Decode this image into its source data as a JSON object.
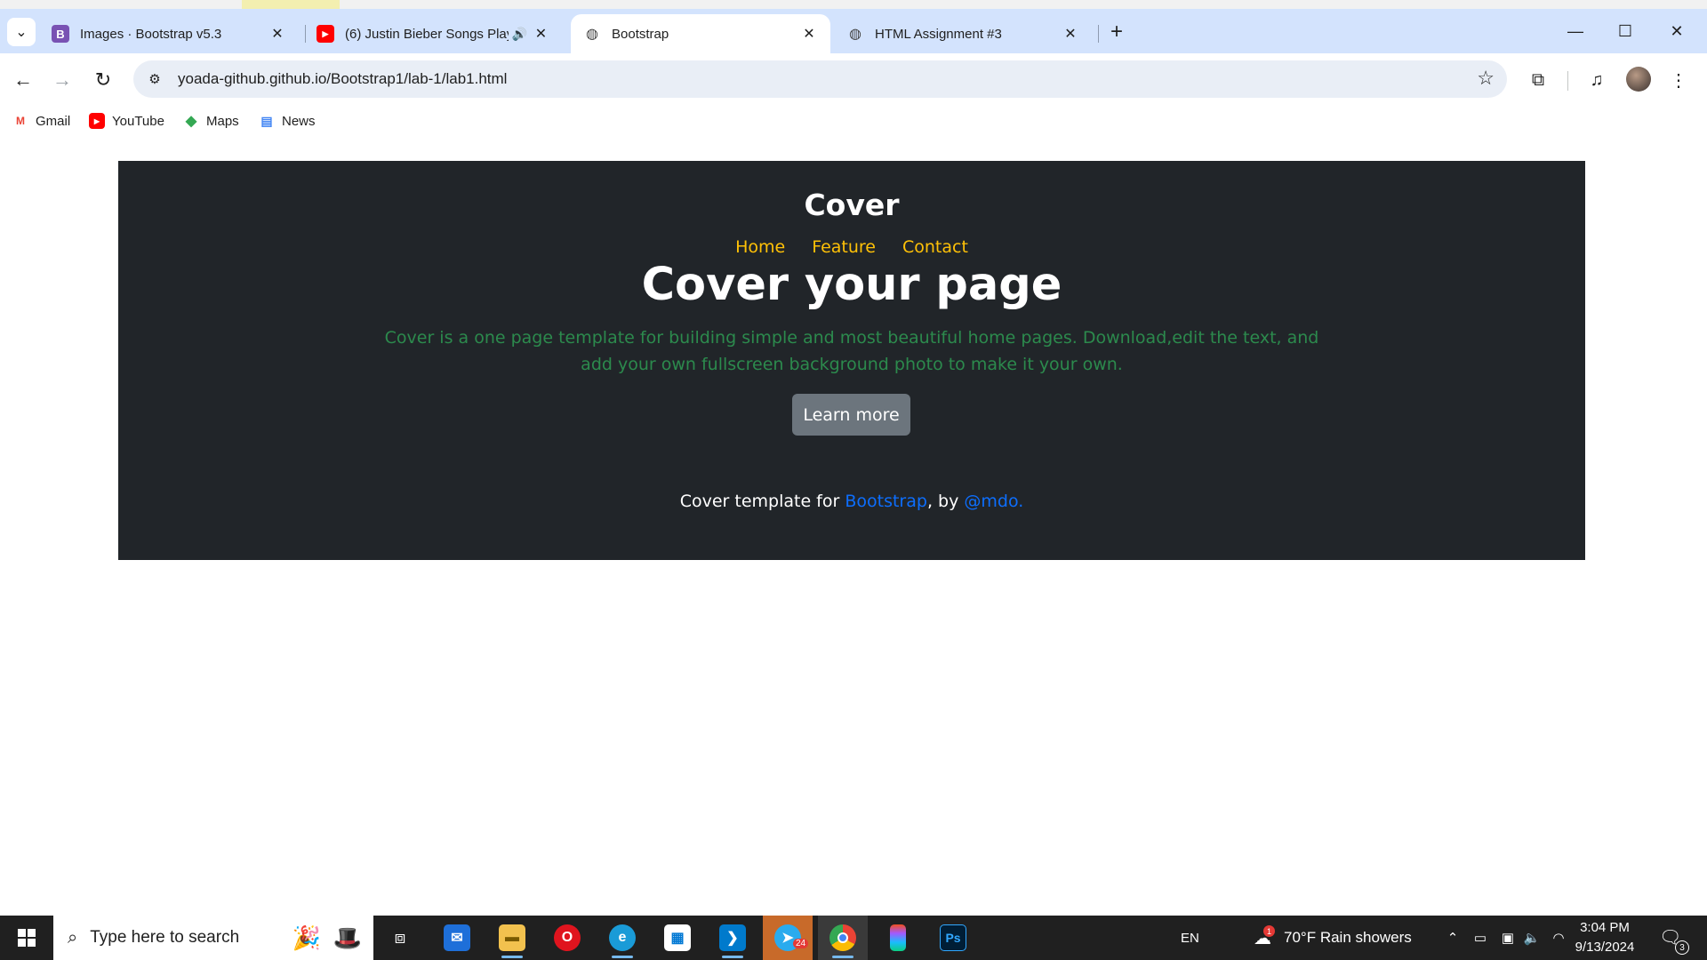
{
  "browser": {
    "tabs": [
      {
        "title": "Images · Bootstrap v5.3",
        "favicon": "B",
        "favicon_color": "#7952b3",
        "active": false
      },
      {
        "title": "(6) Justin Bieber Songs Playl",
        "favicon": "▶",
        "favicon_color": "#ff0000",
        "active": false,
        "audio": true
      },
      {
        "title": "Bootstrap",
        "favicon": "globe",
        "active": true
      },
      {
        "title": "HTML Assignment #3",
        "favicon": "globe",
        "active": false
      }
    ],
    "url": "yoada-github.github.io/Bootstrap1/lab-1/lab1.html",
    "bookmarks": [
      {
        "label": "Gmail",
        "icon": "gmail-icon"
      },
      {
        "label": "YouTube",
        "icon": "youtube-icon"
      },
      {
        "label": "Maps",
        "icon": "maps-icon"
      },
      {
        "label": "News",
        "icon": "news-icon"
      }
    ]
  },
  "page": {
    "brand": "Cover",
    "nav": [
      "Home",
      "Feature",
      "Contact"
    ],
    "headline": "Cover your page",
    "lead": "Cover is a one page template for building simple and most beautiful home pages. Download,edit the text, and add your own fullscreen background photo to make it your own.",
    "button": "Learn more",
    "footer": {
      "prefix": "Cover template for ",
      "link1": "Bootstrap",
      "middle": ", by ",
      "link2": "@mdo."
    },
    "colors": {
      "background": "#212529",
      "nav_link": "#ffc107",
      "lead_text": "#2c8a4d",
      "button": "#6c757d",
      "footer_link": "#0d6efd"
    }
  },
  "taskbar": {
    "search_placeholder": "Type here to search",
    "language": "EN",
    "weather": "70°F  Rain showers",
    "time": "3:04 PM",
    "date": "9/13/2024",
    "notification_count": "3",
    "telegram_badge": "24",
    "weather_badge": "1",
    "apps": [
      "task-view",
      "mail",
      "file-explorer",
      "opera",
      "edge",
      "store",
      "vscode",
      "telegram",
      "chrome",
      "figma",
      "photoshop"
    ]
  }
}
